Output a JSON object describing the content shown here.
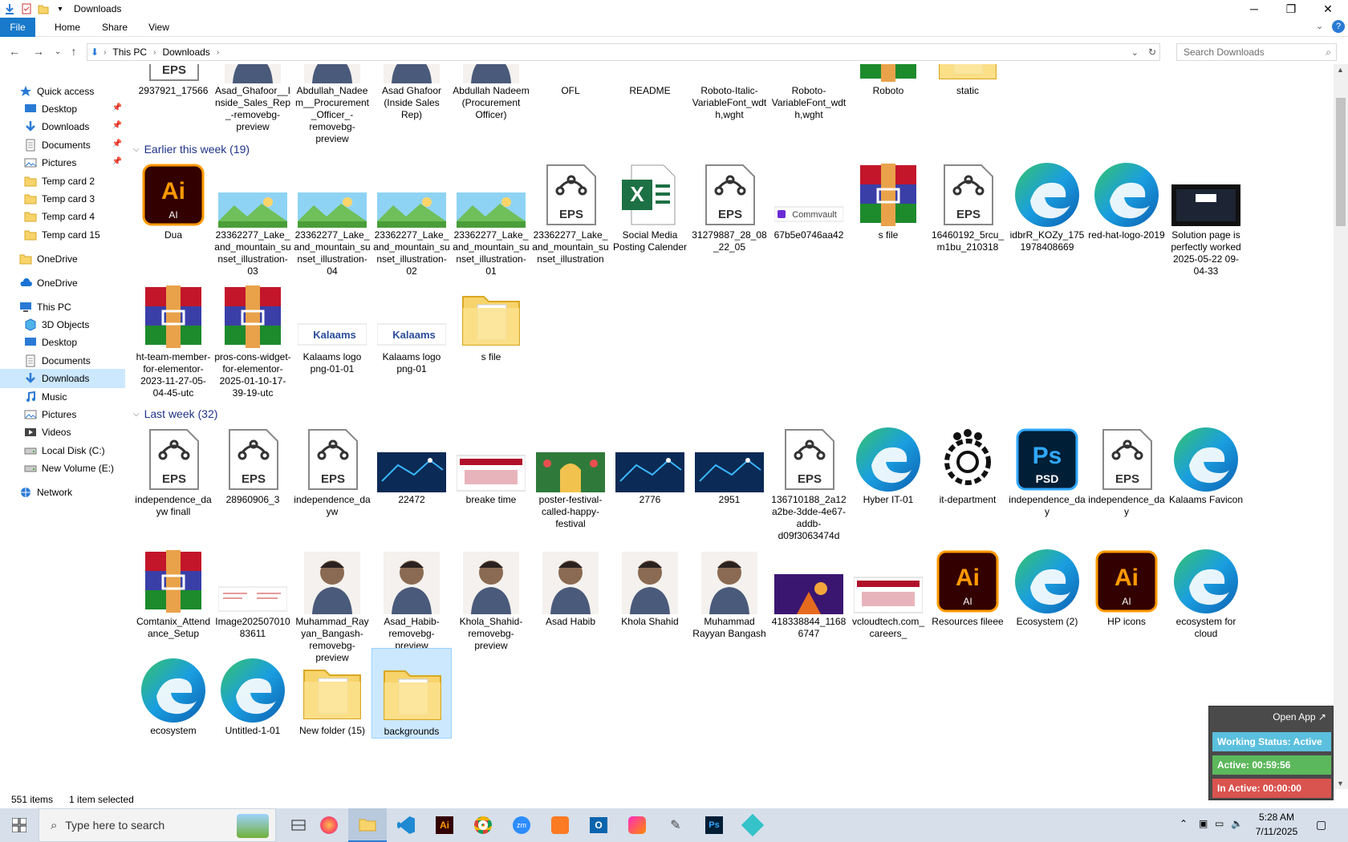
{
  "window": {
    "title": "Downloads"
  },
  "ribbon": {
    "tabs": [
      "File",
      "Home",
      "Share",
      "View"
    ]
  },
  "address": {
    "crumbs": [
      "This PC",
      "Downloads"
    ],
    "search_placeholder": "Search Downloads"
  },
  "nav": {
    "items": [
      {
        "label": "Quick access",
        "icon": "star-icon",
        "level": 0,
        "pinned": false
      },
      {
        "label": "Desktop",
        "icon": "desktop-folder-icon",
        "level": 1,
        "pinned": true
      },
      {
        "label": "Downloads",
        "icon": "download-arrow-icon",
        "level": 1,
        "pinned": true
      },
      {
        "label": "Documents",
        "icon": "documents-icon",
        "level": 1,
        "pinned": true
      },
      {
        "label": "Pictures",
        "icon": "pictures-icon",
        "level": 1,
        "pinned": true
      },
      {
        "label": "Temp card 2",
        "icon": "folder-icon",
        "level": 1,
        "pinned": false
      },
      {
        "label": "Temp card 3",
        "icon": "folder-icon",
        "level": 1,
        "pinned": false
      },
      {
        "label": "Temp card 4",
        "icon": "folder-icon",
        "level": 1,
        "pinned": false
      },
      {
        "label": "Temp card 15",
        "icon": "folder-icon",
        "level": 1,
        "pinned": false
      },
      {
        "label": "OneDrive",
        "icon": "folder-icon",
        "level": 0,
        "pinned": false
      },
      {
        "label": "OneDrive",
        "icon": "cloud-icon",
        "level": 0,
        "pinned": false
      },
      {
        "label": "This PC",
        "icon": "computer-icon",
        "level": 0,
        "pinned": false
      },
      {
        "label": "3D Objects",
        "icon": "cube-icon",
        "level": 1,
        "pinned": false
      },
      {
        "label": "Desktop",
        "icon": "desktop-folder-icon",
        "level": 1,
        "pinned": false
      },
      {
        "label": "Documents",
        "icon": "documents-icon",
        "level": 1,
        "pinned": false
      },
      {
        "label": "Downloads",
        "icon": "download-arrow-icon",
        "level": 1,
        "pinned": false,
        "selected": true
      },
      {
        "label": "Music",
        "icon": "music-icon",
        "level": 1,
        "pinned": false
      },
      {
        "label": "Pictures",
        "icon": "pictures-icon",
        "level": 1,
        "pinned": false
      },
      {
        "label": "Videos",
        "icon": "videos-icon",
        "level": 1,
        "pinned": false
      },
      {
        "label": "Local Disk (C:)",
        "icon": "drive-icon",
        "level": 1,
        "pinned": false
      },
      {
        "label": "New Volume (E:)",
        "icon": "drive-icon",
        "level": 1,
        "pinned": false
      },
      {
        "label": "Network",
        "icon": "network-icon",
        "level": 0,
        "pinned": false
      }
    ]
  },
  "groups": [
    {
      "title": "Earlier this week (19)"
    },
    {
      "title": "Last week (32)"
    }
  ],
  "top_row": [
    {
      "label": "2937921_17566",
      "icon": "eps-icon"
    },
    {
      "label": "Asad_Ghafoor__Inside_Sales_Rep_-removebg-preview",
      "icon": "photo-person-icon"
    },
    {
      "label": "Abdullah_Nadeem__Procurement_Officer_-removebg-preview",
      "icon": "photo-person-icon"
    },
    {
      "label": "Asad Ghafoor (Inside Sales Rep)",
      "icon": "photo-person-icon"
    },
    {
      "label": "Abdullah Nadeem (Procurement Officer)",
      "icon": "photo-person-icon"
    },
    {
      "label": "OFL",
      "icon": "text-file-icon"
    },
    {
      "label": "README",
      "icon": "text-file-icon"
    },
    {
      "label": "Roboto-Italic-VariableFont_wdth,wght",
      "icon": "font-file-icon"
    },
    {
      "label": "Roboto-VariableFont_wdth,wght",
      "icon": "font-file-icon"
    },
    {
      "label": "Roboto",
      "icon": "archive-icon"
    },
    {
      "label": "static",
      "icon": "folder-icon"
    }
  ],
  "earlier": [
    {
      "label": "Dua",
      "icon": "illustrator-icon"
    },
    {
      "label": "23362277_Lake_and_mountain_sunset_illustration-03",
      "icon": "landscape-image-icon"
    },
    {
      "label": "23362277_Lake_and_mountain_sunset_illustration-04",
      "icon": "landscape-image-icon"
    },
    {
      "label": "23362277_Lake_and_mountain_sunset_illustration-02",
      "icon": "landscape-image-icon"
    },
    {
      "label": "23362277_Lake_and_mountain_sunset_illustration-01",
      "icon": "landscape-image-icon"
    },
    {
      "label": "23362277_Lake_and_mountain_sunset_illustration",
      "icon": "eps-icon"
    },
    {
      "label": "Social Media Posting Calender",
      "icon": "excel-icon"
    },
    {
      "label": "31279887_28_08_22_05",
      "icon": "eps-icon"
    },
    {
      "label": "67b5e0746aa42",
      "icon": "commvault-logo-icon"
    },
    {
      "label": "s file",
      "icon": "archive-icon"
    },
    {
      "label": "16460192_5rcu_m1bu_210318",
      "icon": "eps-icon"
    },
    {
      "label": "idbrR_KOZy_1751978408669",
      "icon": "edge-icon"
    },
    {
      "label": "red-hat-logo-2019",
      "icon": "edge-icon"
    },
    {
      "label": "Solution page is perfectly worked 2025-05-22 09-04-33",
      "icon": "video-thumb-icon"
    },
    {
      "label": "ht-team-member-for-elementor-2023-11-27-05-04-45-utc",
      "icon": "archive-icon"
    },
    {
      "label": "pros-cons-widget-for-elementor-2025-01-10-17-39-19-utc",
      "icon": "archive-icon"
    },
    {
      "label": "Kalaams logo png-01-01",
      "icon": "kalaams-logo-icon"
    },
    {
      "label": "Kalaams logo png-01",
      "icon": "kalaams-logo-icon"
    },
    {
      "label": "s file",
      "icon": "folder-icon"
    }
  ],
  "lastweek": [
    {
      "label": "independence_dayw finall",
      "icon": "eps-icon"
    },
    {
      "label": "28960906_3",
      "icon": "eps-icon"
    },
    {
      "label": "independence_dayw",
      "icon": "eps-icon"
    },
    {
      "label": "22472",
      "icon": "tech-image-icon"
    },
    {
      "label": "breake time",
      "icon": "web-image-icon"
    },
    {
      "label": "poster-festival-called-happy-festival",
      "icon": "festival-image-icon"
    },
    {
      "label": "2776",
      "icon": "tech-image-icon"
    },
    {
      "label": "2951",
      "icon": "tech-image-icon"
    },
    {
      "label": "136710188_2a12a2be-3dde-4e67-addb-d09f3063474d",
      "icon": "eps-icon"
    },
    {
      "label": "Hyber IT-01",
      "icon": "edge-icon"
    },
    {
      "label": "it-department",
      "icon": "gear-people-icon"
    },
    {
      "label": "independence_day",
      "icon": "psd-icon"
    },
    {
      "label": "independence_day",
      "icon": "eps-icon"
    },
    {
      "label": "Kalaams Favicon",
      "icon": "edge-icon"
    },
    {
      "label": "Comtanix_Attendance_Setup",
      "icon": "archive-icon"
    },
    {
      "label": "Image20250701083611",
      "icon": "document-image-icon"
    },
    {
      "label": "Muhammad_Rayyan_Bangash-removebg-preview",
      "icon": "photo-person-icon"
    },
    {
      "label": "Asad_Habib-removebg-preview",
      "icon": "photo-person-icon"
    },
    {
      "label": "Khola_Shahid-removebg-preview",
      "icon": "photo-person-icon"
    },
    {
      "label": "Asad Habib",
      "icon": "photo-person-icon"
    },
    {
      "label": "Khola Shahid",
      "icon": "photo-person-icon"
    },
    {
      "label": "Muhammad Rayyan Bangash",
      "icon": "photo-person-icon"
    },
    {
      "label": "418338844_11686747",
      "icon": "purple-image-icon"
    },
    {
      "label": "vcloudtech.com_careers_",
      "icon": "web-image-icon"
    },
    {
      "label": "Resources fileee",
      "icon": "illustrator-icon"
    },
    {
      "label": "Ecosystem (2)",
      "icon": "edge-icon"
    },
    {
      "label": "HP icons",
      "icon": "illustrator-icon"
    },
    {
      "label": "ecosystem for cloud",
      "icon": "edge-icon"
    },
    {
      "label": "ecosystem",
      "icon": "edge-icon"
    },
    {
      "label": "Untitled-1-01",
      "icon": "edge-icon"
    },
    {
      "label": "New folder (15)",
      "icon": "folder-icon"
    },
    {
      "label": "backgrounds",
      "icon": "folder-icon",
      "selected": true
    }
  ],
  "status": {
    "items": "551 items",
    "selected": "1 item selected"
  },
  "widget": {
    "open_app": "Open App ↗",
    "working": "Working Status: Active",
    "active": "Active: 00:59:56",
    "inactive": "In Active: 00:00:00"
  },
  "taskbar": {
    "search_placeholder": "Type here to search",
    "time": "5:28 AM",
    "date": "7/11/2025"
  },
  "colors": {
    "accent": "#1979ca",
    "selected_bg": "#cce8ff",
    "group_title": "#1e3287",
    "working": "#5bc0de",
    "active": "#5cb85c",
    "inactive": "#d9534f"
  }
}
